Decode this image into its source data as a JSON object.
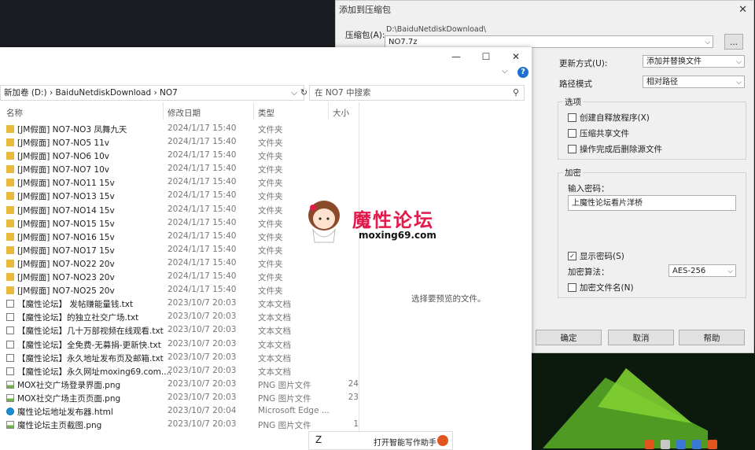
{
  "zip": {
    "title": "添加到压缩包",
    "archive_label": "压缩包(A):",
    "archive_path": "D:\\BaiduNetdiskDownload\\",
    "archive_name": "NO7.7z",
    "browse": "...",
    "update_label": "更新方式(U):",
    "update_value": "添加并替换文件",
    "path_label": "路径模式",
    "path_value": "相对路径",
    "options_title": "选项",
    "opt1": "创建自释放程序(X)",
    "opt2": "压缩共享文件",
    "opt3": "操作完成后删除源文件",
    "enc_title": "加密",
    "pw_label": "输入密码：",
    "pw_value": "上魔性论坛看片洋桥",
    "show_pw": "显示密码(S)",
    "method_label": "加密算法：",
    "method_value": "AES-256",
    "enc_names": "加密文件名(N)",
    "ok": "确定",
    "cancel": "取消",
    "help": "帮助"
  },
  "explorer": {
    "address": "新加卷 (D:)  ›  BaiduNetdiskDownload  ›  NO7",
    "search_placeholder": "在 NO7 中搜索",
    "cols": {
      "name": "名称",
      "date": "修改日期",
      "type": "类型",
      "size": "大小"
    },
    "preview_msg": "选择要预览的文件。",
    "files": [
      {
        "icon": "folder",
        "name": "[JM假面] NO7-NO3 凤舞九天",
        "date": "2024/1/17 15:40",
        "type": "文件夹",
        "size": ""
      },
      {
        "icon": "folder",
        "name": "[JM假面] NO7-NO5 11v",
        "date": "2024/1/17 15:40",
        "type": "文件夹",
        "size": ""
      },
      {
        "icon": "folder",
        "name": "[JM假面] NO7-NO6 10v",
        "date": "2024/1/17 15:40",
        "type": "文件夹",
        "size": ""
      },
      {
        "icon": "folder",
        "name": "[JM假面] NO7-NO7 10v",
        "date": "2024/1/17 15:40",
        "type": "文件夹",
        "size": ""
      },
      {
        "icon": "folder",
        "name": "[JM假面] NO7-NO11 15v",
        "date": "2024/1/17 15:40",
        "type": "文件夹",
        "size": ""
      },
      {
        "icon": "folder",
        "name": "[JM假面] NO7-NO13 15v",
        "date": "2024/1/17 15:40",
        "type": "文件夹",
        "size": ""
      },
      {
        "icon": "folder",
        "name": "[JM假面] NO7-NO14 15v",
        "date": "2024/1/17 15:40",
        "type": "文件夹",
        "size": ""
      },
      {
        "icon": "folder",
        "name": "[JM假面] NO7-NO15 15v",
        "date": "2024/1/17 15:40",
        "type": "文件夹",
        "size": ""
      },
      {
        "icon": "folder",
        "name": "[JM假面] NO7-NO16 15v",
        "date": "2024/1/17 15:40",
        "type": "文件夹",
        "size": ""
      },
      {
        "icon": "folder",
        "name": "[JM假面] NO7-NO17 15v",
        "date": "2024/1/17 15:40",
        "type": "文件夹",
        "size": ""
      },
      {
        "icon": "folder",
        "name": "[JM假面] NO7-NO22 20v",
        "date": "2024/1/17 15:40",
        "type": "文件夹",
        "size": ""
      },
      {
        "icon": "folder",
        "name": "[JM假面] NO7-NO23 20v",
        "date": "2024/1/17 15:40",
        "type": "文件夹",
        "size": ""
      },
      {
        "icon": "folder",
        "name": "[JM假面] NO7-NO25 20v",
        "date": "2024/1/17 15:40",
        "type": "文件夹",
        "size": ""
      },
      {
        "icon": "txt",
        "name": "【魔性论坛】 发帖赚能量钱.txt",
        "date": "2023/10/7 20:03",
        "type": "文本文档",
        "size": ""
      },
      {
        "icon": "txt",
        "name": "【魔性论坛】的独立社交广场.txt",
        "date": "2023/10/7 20:03",
        "type": "文本文档",
        "size": ""
      },
      {
        "icon": "txt",
        "name": "【魔性论坛】几十万部视频在线观看.txt",
        "date": "2023/10/7 20:03",
        "type": "文本文档",
        "size": ""
      },
      {
        "icon": "txt",
        "name": "【魔性论坛】全免费-无募捐-更新快.txt",
        "date": "2023/10/7 20:03",
        "type": "文本文档",
        "size": ""
      },
      {
        "icon": "txt",
        "name": "【魔性论坛】永久地址发布页及邮箱.txt",
        "date": "2023/10/7 20:03",
        "type": "文本文档",
        "size": ""
      },
      {
        "icon": "txt",
        "name": "【魔性论坛】永久网址moxing69.com....",
        "date": "2023/10/7 20:03",
        "type": "文本文档",
        "size": ""
      },
      {
        "icon": "png",
        "name": "MOX社交广场登录界面.png",
        "date": "2023/10/7 20:03",
        "type": "PNG 图片文件",
        "size": "24"
      },
      {
        "icon": "png",
        "name": "MOX社交广场主页页面.png",
        "date": "2023/10/7 20:03",
        "type": "PNG 图片文件",
        "size": "23"
      },
      {
        "icon": "html",
        "name": "魔性论坛地址发布器.html",
        "date": "2023/10/7 20:04",
        "type": "Microsoft Edge ...",
        "size": ""
      },
      {
        "icon": "png",
        "name": "魔性论坛主页截图.png",
        "date": "2023/10/7 20:03",
        "type": "PNG 图片文件",
        "size": "1"
      }
    ]
  },
  "watermark": {
    "logo": "魔性论坛",
    "site": "moxing69.com"
  },
  "ime": {
    "typed": "Z",
    "hint": "打开智能写作助手"
  }
}
